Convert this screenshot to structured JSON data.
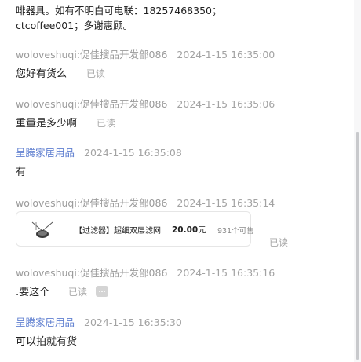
{
  "top_text": "啡器具。如有不明白可电联：18257468350；ctcoffee001；多谢惠顾。",
  "messages": [
    {
      "sender": "woloveshuqi:促佳搜品开发部086",
      "time": "2024-1-15 16:35:00",
      "text": "您好有货么",
      "status": "已读"
    },
    {
      "sender": "woloveshuqi:促佳搜品开发部086",
      "time": "2024-1-15 16:35:06",
      "text": "重量是多少啊",
      "status": "已读"
    },
    {
      "sender": "呈腾家居用品",
      "time": "2024-1-15 16:35:08",
      "text": "有"
    },
    {
      "sender": "woloveshuqi:促佳搜品开发部086",
      "time": "2024-1-15 16:35:14",
      "status": "已读",
      "product_card": {
        "title": "【过滤器】超细双层滤网",
        "price": "20.00",
        "price_unit": "元",
        "sold": "931个可售"
      }
    },
    {
      "sender": "woloveshuqi:促佳搜品开发部086",
      "time": "2024-1-15 16:35:16",
      "text": ".要这个",
      "status": "已读"
    },
    {
      "sender": "呈腾家居用品",
      "time": "2024-1-15 16:35:30",
      "text": "可以拍就有货"
    }
  ]
}
